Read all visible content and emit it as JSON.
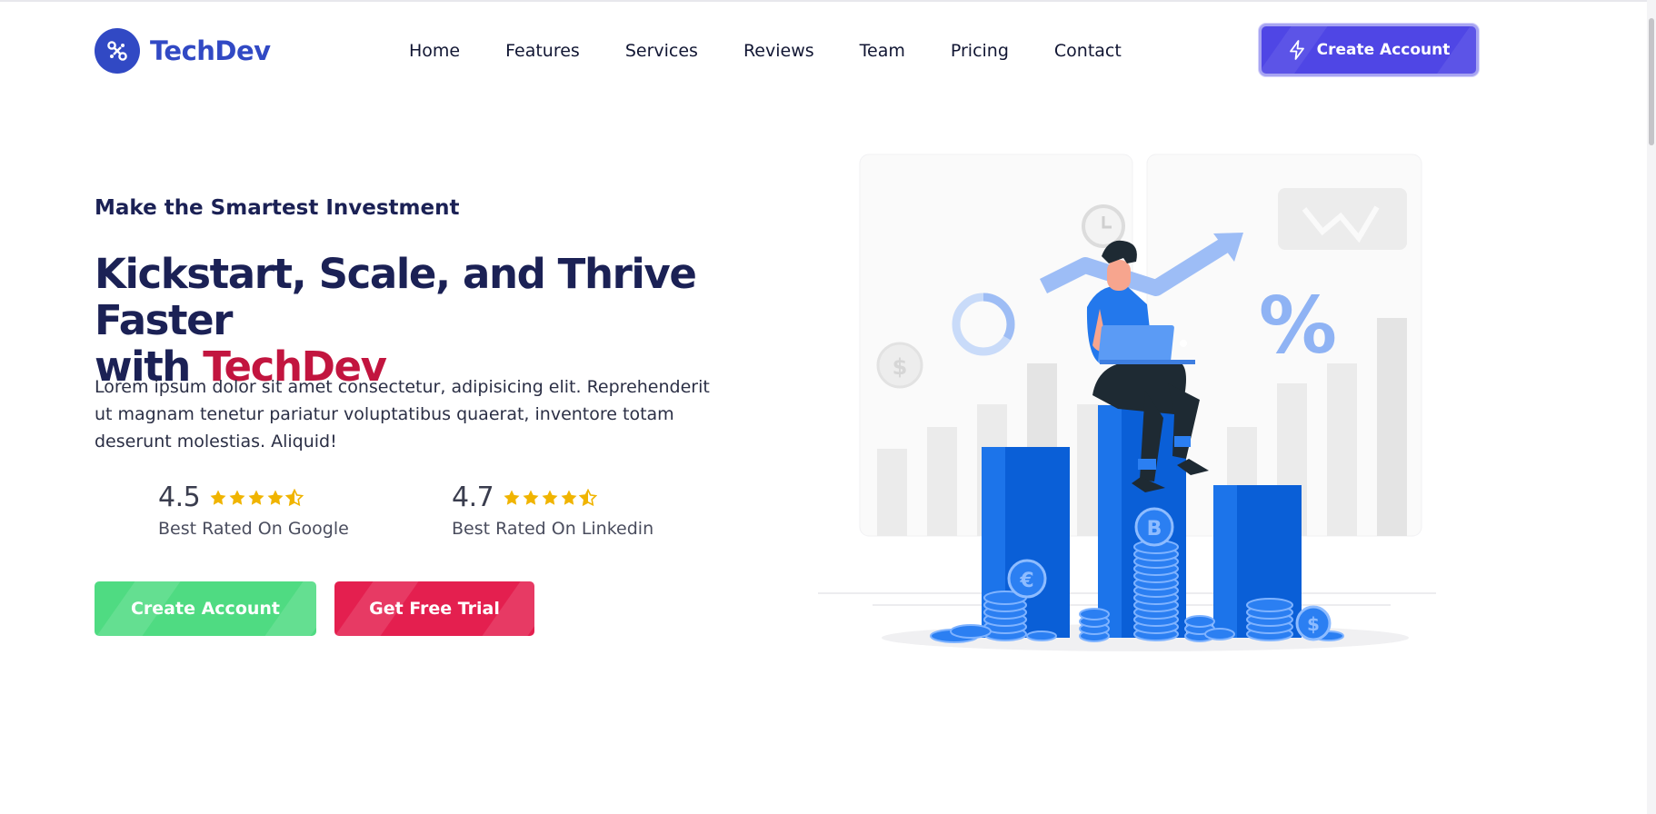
{
  "brand": {
    "name": "TechDev",
    "accent": "#3149c4"
  },
  "nav": {
    "items": [
      {
        "label": "Home"
      },
      {
        "label": "Features"
      },
      {
        "label": "Services"
      },
      {
        "label": "Reviews"
      },
      {
        "label": "Team"
      },
      {
        "label": "Pricing"
      },
      {
        "label": "Contact"
      }
    ]
  },
  "header_cta": {
    "label": "Create Account",
    "icon": "bolt-icon",
    "color": "#4f46e5"
  },
  "hero": {
    "eyebrow": "Make the Smartest Investment",
    "headline": "Kickstart, Scale, and Thrive Faster",
    "headline_prefix": "with",
    "headline_brand": "TechDev",
    "headline_brand_color": "#c2153f",
    "lead": "Lorem ipsum dolor sit amet consectetur, adipisicing elit. Reprehenderit ut magnam tenetur pariatur voluptatibus quaerat, inventore totam deserunt molestias. Aliquid!",
    "ratings": [
      {
        "score": "4.5",
        "stars": 4.5,
        "label": "Best Rated On Google"
      },
      {
        "score": "4.7",
        "stars": 4.5,
        "label": "Best Rated On Linkedin"
      }
    ],
    "buttons": {
      "primary": {
        "label": "Create Account",
        "color": "#4fdb82"
      },
      "secondary": {
        "label": "Get Free Trial",
        "color": "#e41f4f"
      }
    }
  },
  "illustration": {
    "icon": "investment-growth-illustration",
    "star_color": "#f0b400"
  }
}
